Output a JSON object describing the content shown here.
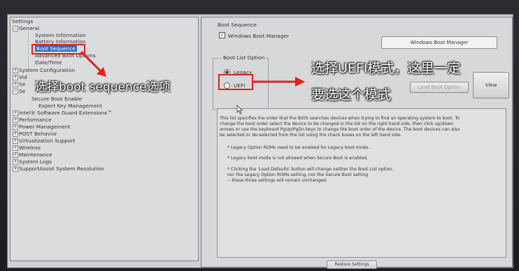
{
  "nav": {
    "root": "Settings",
    "items": [
      {
        "label": "General"
      },
      {
        "label": "System Information"
      },
      {
        "label": "Battery Information"
      },
      {
        "label": "Boot Sequence"
      },
      {
        "label": "Advanced Boot Options"
      },
      {
        "label": "Date/Time"
      },
      {
        "label": "System Configuration"
      },
      {
        "label": "Vid"
      },
      {
        "label": "Se"
      },
      {
        "label": "Se"
      },
      {
        "label": "Secure Boot Enable"
      },
      {
        "label": "Expert Key Management"
      },
      {
        "label": "Intel® Software Guard Extensions™"
      },
      {
        "label": "Performance"
      },
      {
        "label": "Power Management"
      },
      {
        "label": "POST Behavior"
      },
      {
        "label": "Virtualization Support"
      },
      {
        "label": "Wireless"
      },
      {
        "label": "Maintenance"
      },
      {
        "label": "System Logs"
      },
      {
        "label": "SupportAssist System Resolution"
      }
    ]
  },
  "boot_sequence": {
    "title": "Boot Sequence",
    "entry_label": "Windows Boot Manager",
    "entry_checked": true,
    "list_box_item": "Windows Boot Manager"
  },
  "boot_list_option": {
    "title": "Boot List Option",
    "legacy_label": "Legacy",
    "uefi_label": "UEFI",
    "selected": "Legacy"
  },
  "buttons": {
    "load_defaults": "Load Boot Option",
    "view": "View",
    "restore": "Restore Settings"
  },
  "description": {
    "lines": [
      "This list specifies the order that the BIOS searches devices when trying to find an operating system to boot. To",
      "change the boot order select the device to be changed in the list on the right hand side, then click up/down",
      "arrows or use the keyboard PgUp/PgDn keys to change the boot order of the device. The boot devices can also",
      "be selected or de-selected from the list using the check boxes on the left hand side."
    ],
    "notes": [
      "* Legacy Option ROMs need to be enabled for Legacy boot mode.",
      "* Legacy boot mode is not allowed when Secure Boot is enabled.",
      "* Clicking the 'Load Defaults' button will change neither the Boot List option,",
      "  nor the Legacy Option ROMs setting, nor the Secure Boot setting",
      "  -- these three settings will remain unchanged."
    ]
  },
  "annotations": {
    "left_text": "选择boot sequence选项",
    "right_text_1": "选择UEFI模式，这里一定",
    "right_text_2": "要选这个模式"
  },
  "colors": {
    "annotation_red": "#e0221c",
    "selection_blue": "#2f6cbf"
  }
}
